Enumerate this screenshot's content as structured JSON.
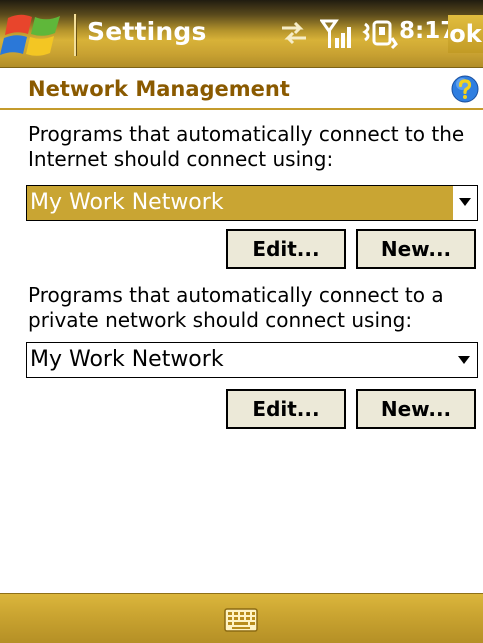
{
  "titlebar": {
    "title": "Settings",
    "time": "8:17",
    "ok_label": "ok",
    "icons": [
      "start-menu-icon",
      "connectivity-icon",
      "signal-strength-icon",
      "vibrate-icon"
    ]
  },
  "header": {
    "title": "Network Management",
    "help_icon": "help-icon"
  },
  "internet_section": {
    "label": "Programs that automatically connect to the Internet should connect using:",
    "selected_network": "My Work Network",
    "edit_label": "Edit...",
    "new_label": "New..."
  },
  "private_section": {
    "label": "Programs that automatically connect to a private network should connect using:",
    "selected_network": "My Work Network",
    "edit_label": "Edit...",
    "new_label": "New..."
  },
  "bottombar": {
    "icon": "keyboard-icon"
  },
  "colors": {
    "accent": "#c9a533",
    "header_text": "#8a5a00",
    "button_face": "#ece9d8"
  }
}
